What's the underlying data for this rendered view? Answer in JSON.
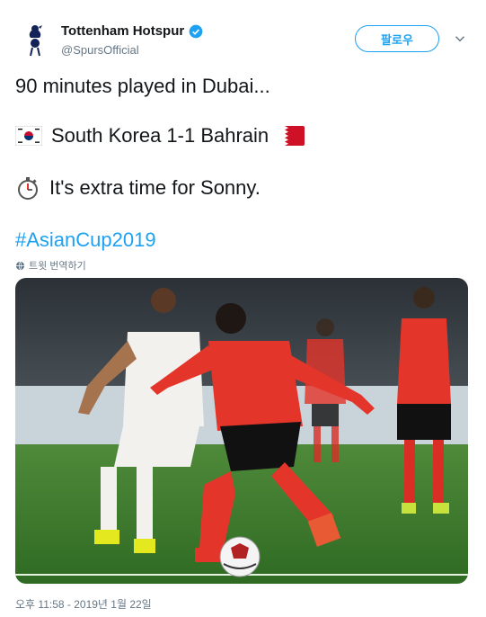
{
  "account": {
    "name": "Tottenham Hotspur",
    "handle": "@SpursOfficial",
    "avatar_icon": "spurs-cockerel-logo",
    "verified_icon": "verified-badge-icon"
  },
  "actions": {
    "follow_label": "팔로우",
    "more_icon": "chevron-down-icon"
  },
  "tweet": {
    "line1": "90 minutes played in Dubai...",
    "line2": "South Korea 1-1 Bahrain",
    "line3": "It's extra time for Sonny.",
    "hashtag": "#AsianCup2019",
    "flag_left_icon": "south-korea-flag-icon",
    "flag_right_icon": "bahrain-flag-icon",
    "stopwatch_icon": "stopwatch-icon"
  },
  "translate": {
    "label": "트윗 번역하기",
    "icon": "globe-icon"
  },
  "media": {
    "description_icon": "match-photo"
  },
  "meta": {
    "timestamp": "오후 11:58 - 2019년 1월 22일"
  },
  "colors": {
    "accent": "#1da1f2",
    "secondary_text": "#657786",
    "primary_text": "#14171a"
  }
}
